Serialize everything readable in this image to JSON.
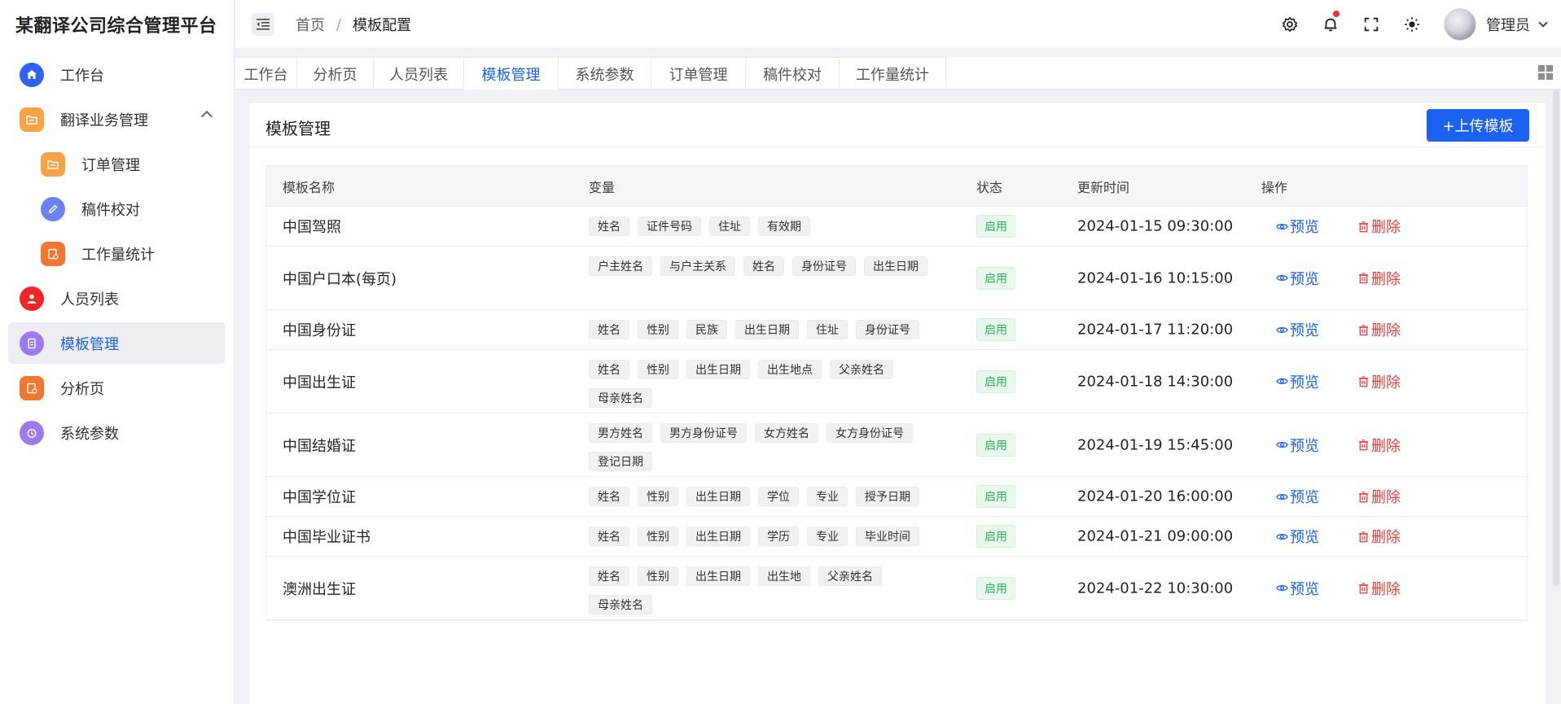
{
  "app": {
    "title": "某翻译公司综合管理平台"
  },
  "sidebar": {
    "items": [
      {
        "label": "工作台",
        "icon": "home-icon",
        "color": "#2d63f0"
      },
      {
        "label": "翻译业务管理",
        "icon": "folder-icon",
        "color": "#f7a346"
      },
      {
        "label": "订单管理",
        "icon": "folder-icon",
        "color": "#f7a346"
      },
      {
        "label": "稿件校对",
        "icon": "pen-icon",
        "color": "#6b83f0"
      },
      {
        "label": "工作量统计",
        "icon": "chart-doc-icon",
        "color": "#f2762d"
      },
      {
        "label": "人员列表",
        "icon": "user-icon",
        "color": "#f02626"
      },
      {
        "label": "模板管理",
        "icon": "template-icon",
        "color": "#9b7af0"
      },
      {
        "label": "分析页",
        "icon": "analysis-icon",
        "color": "#f2762d"
      },
      {
        "label": "系统参数",
        "icon": "settings-clock-icon",
        "color": "#9b7af0"
      }
    ]
  },
  "header": {
    "breadcrumb": {
      "home": "首页",
      "separator": "/",
      "current": "模板配置"
    },
    "user": {
      "name": "管理员"
    }
  },
  "tabs": [
    "工作台",
    "分析页",
    "人员列表",
    "模板管理",
    "系统参数",
    "订单管理",
    "稿件校对",
    "工作量统计"
  ],
  "active_tab": "模板管理",
  "card": {
    "title": "模板管理",
    "upload_label": "+上传模板"
  },
  "table": {
    "headers": {
      "name": "模板名称",
      "vars": "变量",
      "status": "状态",
      "time": "更新时间",
      "ops": "操作"
    },
    "preview_label": "预览",
    "delete_label": "删除",
    "rows": [
      {
        "name": "中国驾照",
        "vars": [
          "姓名",
          "证件号码",
          "住址",
          "有效期"
        ],
        "status": "启用",
        "time": "2024-01-15 09:30:00"
      },
      {
        "name": "中国户口本(每页)",
        "vars": [
          "户主姓名",
          "与户主关系",
          "姓名",
          "身份证号",
          "出生日期"
        ],
        "status": "启用",
        "time": "2024-01-16 10:15:00"
      },
      {
        "name": "中国身份证",
        "vars": [
          "姓名",
          "性别",
          "民族",
          "出生日期",
          "住址",
          "身份证号"
        ],
        "status": "启用",
        "time": "2024-01-17 11:20:00"
      },
      {
        "name": "中国出生证",
        "vars": [
          "姓名",
          "性别",
          "出生日期",
          "出生地点",
          "父亲姓名",
          "母亲姓名"
        ],
        "status": "启用",
        "time": "2024-01-18 14:30:00"
      },
      {
        "name": "中国结婚证",
        "vars": [
          "男方姓名",
          "男方身份证号",
          "女方姓名",
          "女方身份证号",
          "登记日期"
        ],
        "status": "启用",
        "time": "2024-01-19 15:45:00"
      },
      {
        "name": "中国学位证",
        "vars": [
          "姓名",
          "性别",
          "出生日期",
          "学位",
          "专业",
          "授予日期"
        ],
        "status": "启用",
        "time": "2024-01-20 16:00:00"
      },
      {
        "name": "中国毕业证书",
        "vars": [
          "姓名",
          "性别",
          "出生日期",
          "学历",
          "专业",
          "毕业时间"
        ],
        "status": "启用",
        "time": "2024-01-21 09:00:00"
      },
      {
        "name": "澳洲出生证",
        "vars": [
          "姓名",
          "性别",
          "出生日期",
          "出生地",
          "父亲姓名",
          "母亲姓名"
        ],
        "status": "启用",
        "time": "2024-01-22 10:30:00"
      }
    ]
  }
}
